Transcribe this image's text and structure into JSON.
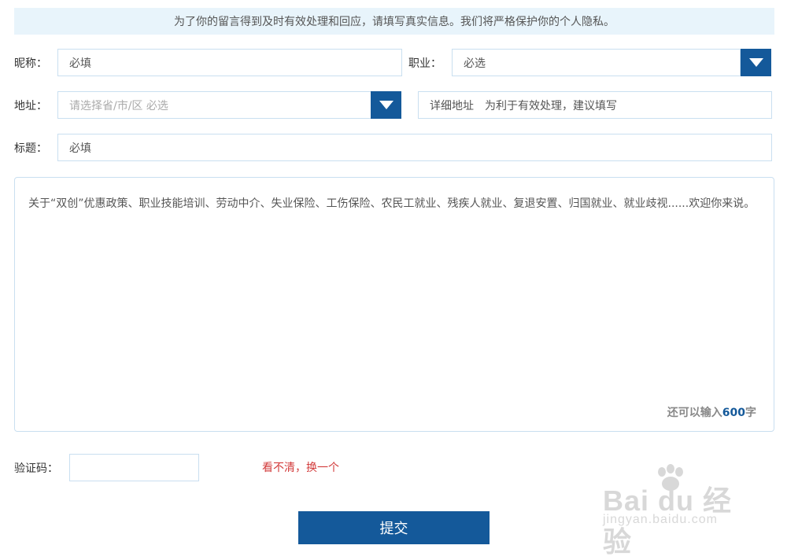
{
  "notice": "为了你的留言得到及时有效处理和回应，请填写真实信息。我们将严格保护你的个人隐私。",
  "nickname": {
    "label": "昵称：",
    "value": "必填"
  },
  "occupation": {
    "label": "职业：",
    "value": "必选"
  },
  "address": {
    "label": "地址：",
    "region_placeholder": "请选择省/市/区 必选",
    "detail_placeholder": "详细地址　为利于有效处理，建议填写"
  },
  "title": {
    "label": "标题：",
    "value": "必填"
  },
  "message": {
    "hint": "关于“双创”优惠政策、职业技能培训、劳动中介、失业保险、工伤保险、农民工就业、残疾人就业、复退安置、归国就业、就业歧视......欢迎你来说。",
    "counter_prefix": "还可以输入",
    "counter_value": "600",
    "counter_suffix": "字"
  },
  "captcha": {
    "label": "验证码：",
    "value": "",
    "refresh_link": "看不清，换一个"
  },
  "submit_label": "提交",
  "watermark": {
    "brand": "Bai du 经验",
    "url": "jingyan.baidu.com"
  },
  "colors": {
    "accent": "#14599a",
    "notice_bg": "#e8f4fb",
    "link_red": "#d23b3b",
    "border": "#c9dff0"
  },
  "icons": {
    "dropdown": "caret-down-icon",
    "watermark_logo": "baidu-paw-icon"
  }
}
